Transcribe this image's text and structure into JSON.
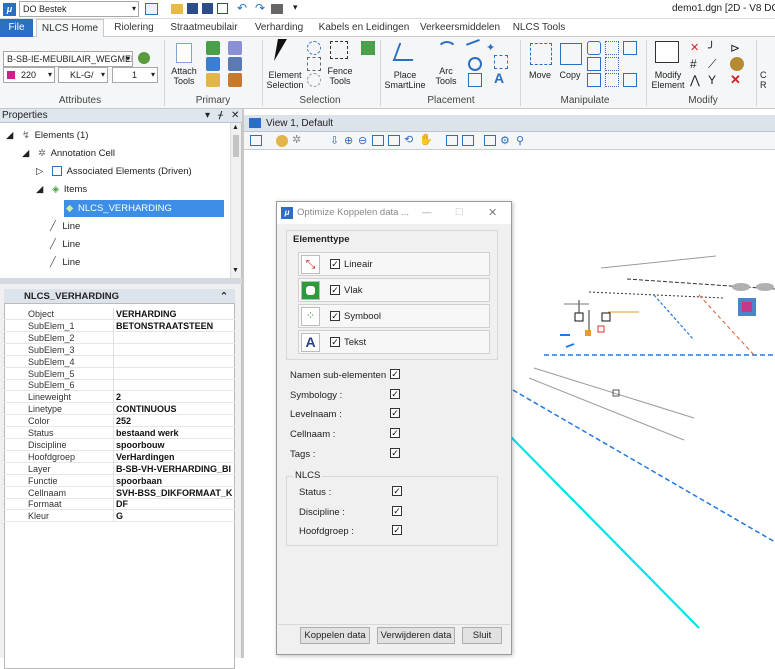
{
  "titlebar": {
    "workspace": "DO Bestek",
    "doc_title": "demo1.dgn [2D - V8 DGN"
  },
  "tabs": [
    "File",
    "NLCS Home",
    "Riolering",
    "Straatmeubilair",
    "Verharding",
    "Kabels en Leidingen",
    "Verkeersmiddelen",
    "NLCS Tools"
  ],
  "ribbon": {
    "attributes": {
      "level": "B-SB-IE-MEUBILAIR_WEGMEL",
      "color": "220",
      "style": "KL-G/",
      "weight": "1",
      "label": "Attributes"
    },
    "primary": {
      "attach": "Attach",
      "tools": "Tools",
      "label": "Primary"
    },
    "selection": {
      "element": "Element",
      "selection": "Selection",
      "fence": "Fence",
      "tools": "Tools",
      "label": "Selection"
    },
    "placement": {
      "place": "Place",
      "smartline": "SmartLine",
      "arc": "Arc",
      "tools": "Tools",
      "label": "Placement"
    },
    "manipulate": {
      "move": "Move",
      "copy": "Copy",
      "label": "Manipulate"
    },
    "modify": {
      "modify": "Modify",
      "element": "Element",
      "label": "Modify"
    },
    "extra": {
      "c": "C",
      "r": "R"
    }
  },
  "properties_panel": {
    "title": "Properties",
    "tree": [
      {
        "label": "Elements (1)"
      },
      {
        "label": "Annotation Cell"
      },
      {
        "label": "Associated Elements (Driven)"
      },
      {
        "label": "Items"
      },
      {
        "label": "NLCS_VERHARDING"
      },
      {
        "label": "Line"
      },
      {
        "label": "Line"
      },
      {
        "label": "Line"
      }
    ],
    "section_title": "NLCS_VERHARDING",
    "rows": [
      {
        "k": "Object",
        "v": "VERHARDING"
      },
      {
        "k": "SubElem_1",
        "v": "BETONSTRAATSTEEN"
      },
      {
        "k": "SubElem_2",
        "v": ""
      },
      {
        "k": "SubElem_3",
        "v": ""
      },
      {
        "k": "SubElem_4",
        "v": ""
      },
      {
        "k": "SubElem_5",
        "v": ""
      },
      {
        "k": "SubElem_6",
        "v": ""
      },
      {
        "k": "Lineweight",
        "v": "2"
      },
      {
        "k": "Linetype",
        "v": "CONTINUOUS"
      },
      {
        "k": "Color",
        "v": "252"
      },
      {
        "k": "Status",
        "v": "bestaand werk"
      },
      {
        "k": "Discipline",
        "v": "spoorbouw"
      },
      {
        "k": "Hoofdgroep",
        "v": "VerHardingen"
      },
      {
        "k": "Layer",
        "v": "B-SB-VH-VERHARDING_BI"
      },
      {
        "k": "Functie",
        "v": "spoorbaan"
      },
      {
        "k": "Cellnaam",
        "v": "SVH-BSS_DIKFORMAAT_K"
      },
      {
        "k": "Formaat",
        "v": "DF"
      },
      {
        "k": "Kleur",
        "v": "G"
      }
    ]
  },
  "view": {
    "title": "View 1, Default"
  },
  "dialog": {
    "title": "Optimize Koppelen data ...",
    "elementtype_label": "Elementtype",
    "types": [
      {
        "label": "Lineair",
        "checked": "✓"
      },
      {
        "label": "Vlak",
        "checked": "✓"
      },
      {
        "label": "Symbool",
        "checked": "✓"
      },
      {
        "label": "Tekst",
        "checked": "✓"
      }
    ],
    "options": [
      {
        "label": "Namen sub-elementen",
        "checked": "✓"
      },
      {
        "label": "Symbology :",
        "checked": "✓"
      },
      {
        "label": "Levelnaam :",
        "checked": "✓"
      },
      {
        "label": "Cellnaam :",
        "checked": "✓"
      },
      {
        "label": "Tags :",
        "checked": "✓"
      }
    ],
    "nlcs_label": "NLCS",
    "nlcs": [
      {
        "label": "Status :",
        "checked": "✓"
      },
      {
        "label": "Discipline :",
        "checked": "✓"
      },
      {
        "label": "Hoofdgroep :",
        "checked": "✓"
      }
    ],
    "buttons": {
      "koppelen": "Koppelen data",
      "verwijderen": "Verwijderen data",
      "sluit": "Sluit"
    }
  },
  "colors": {
    "accent": "#2b6fc2",
    "selection": "#3d8ee6",
    "cyan": "#00e5e5",
    "blue_dash": "#1e78e6"
  }
}
